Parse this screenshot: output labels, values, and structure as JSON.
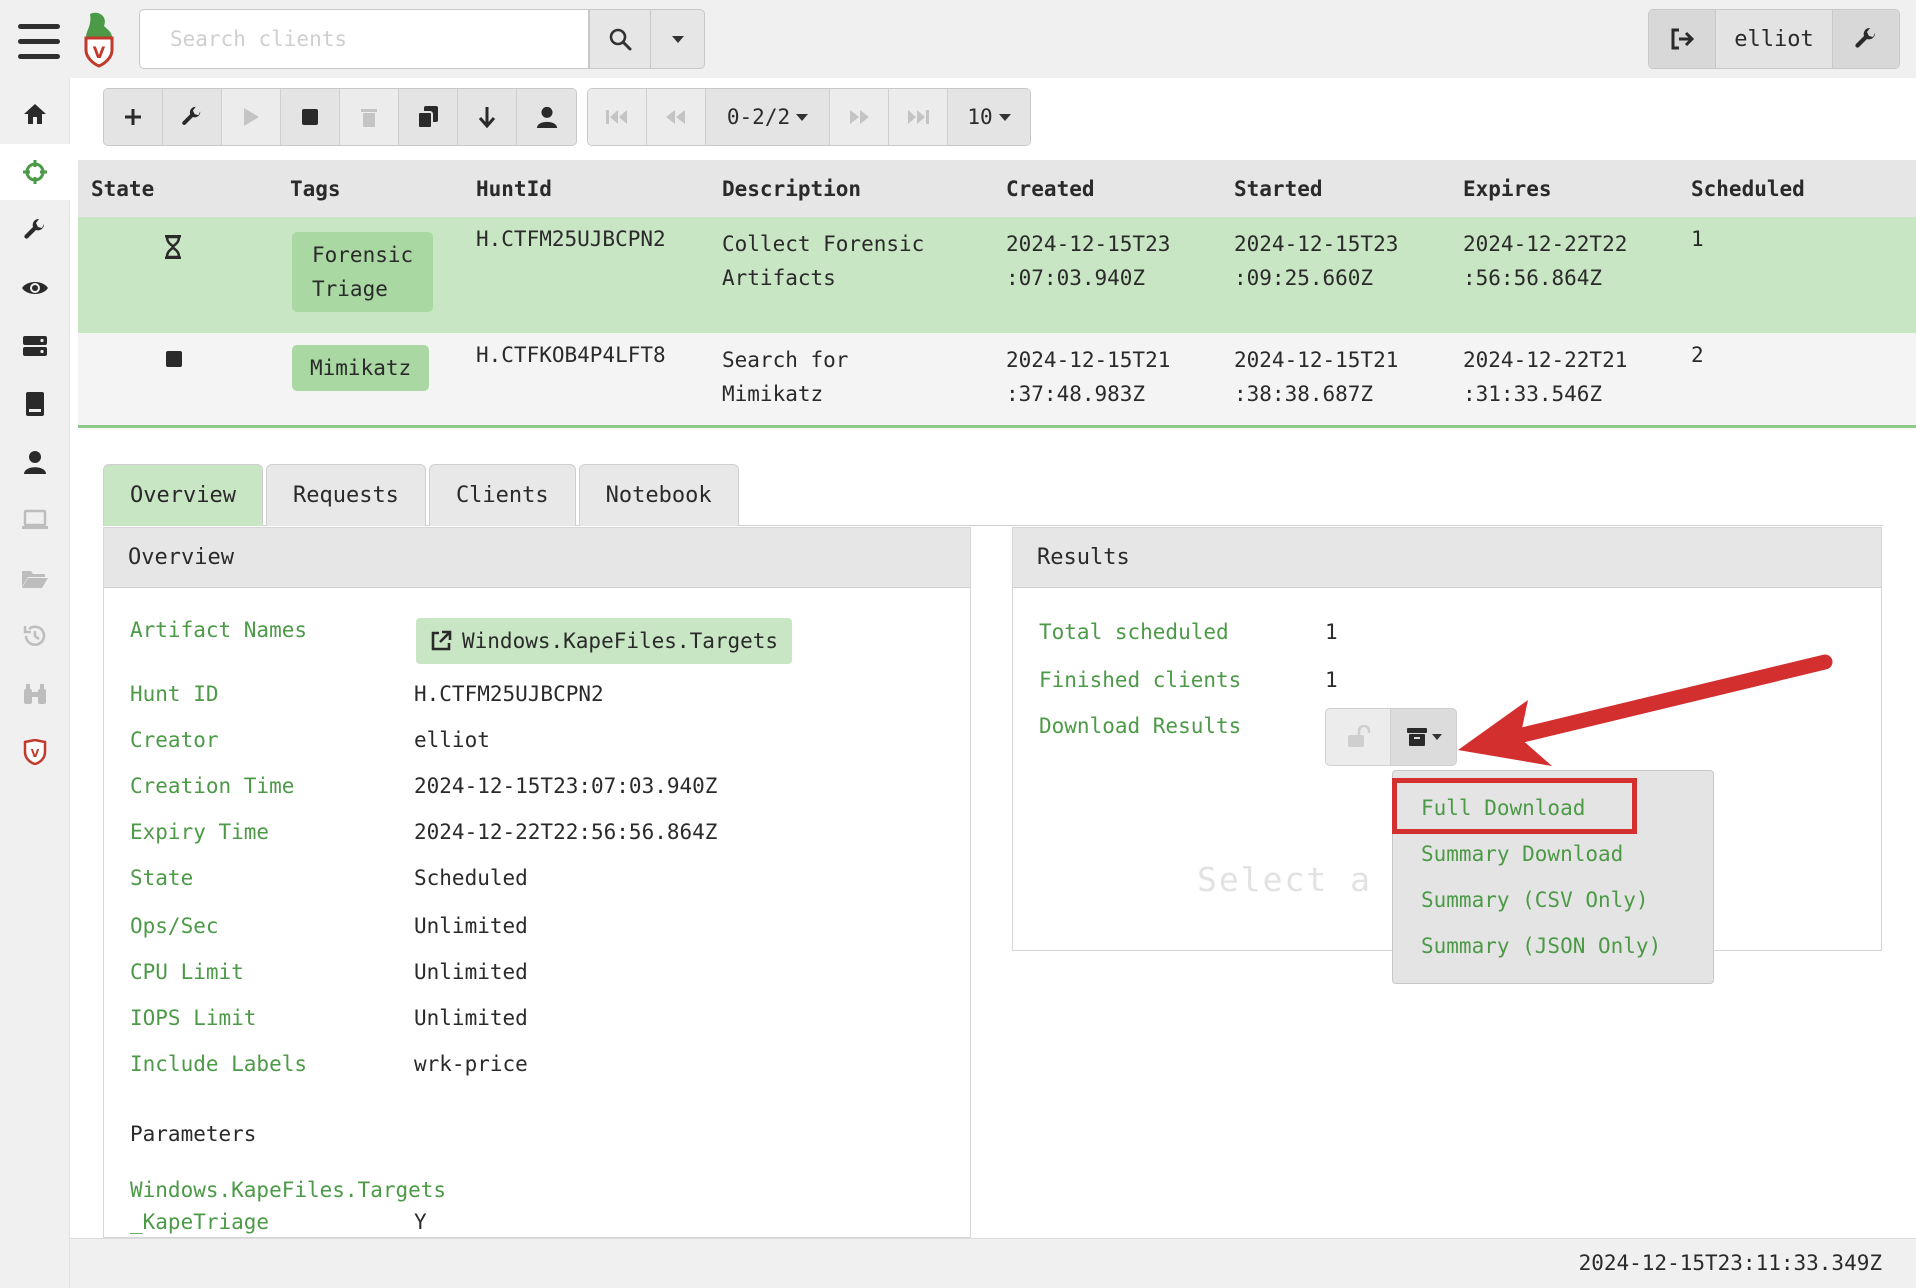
{
  "header": {
    "search_placeholder": "Search clients",
    "username": "elliot"
  },
  "toolbar": {
    "pager_label": "0-2/2",
    "page_size": "10"
  },
  "hunts_table": {
    "columns": [
      "State",
      "Tags",
      "HuntId",
      "Description",
      "Created",
      "Started",
      "Expires",
      "Scheduled"
    ],
    "rows": [
      {
        "state_icon": "hourglass-icon",
        "tag": [
          "Forensic",
          "Triage"
        ],
        "hunt_id": "H.CTFM25UJBCPN2",
        "description": [
          "Collect Forensic",
          "Artifacts"
        ],
        "created": [
          "2024-12-15T23",
          ":07:03.940Z"
        ],
        "started": [
          "2024-12-15T23",
          ":09:25.660Z"
        ],
        "expires": [
          "2024-12-22T22",
          ":56:56.864Z"
        ],
        "scheduled": "1"
      },
      {
        "state_icon": "stop-icon",
        "tag": [
          "Mimikatz"
        ],
        "hunt_id": "H.CTFKOB4P4LFT8",
        "description": [
          "Search for",
          "Mimikatz"
        ],
        "created": [
          "2024-12-15T21",
          ":37:48.983Z"
        ],
        "started": [
          "2024-12-15T21",
          ":38:38.687Z"
        ],
        "expires": [
          "2024-12-22T21",
          ":31:33.546Z"
        ],
        "scheduled": "2"
      }
    ]
  },
  "tabs": [
    "Overview",
    "Requests",
    "Clients",
    "Notebook"
  ],
  "overview": {
    "title": "Overview",
    "artifact_names_label": "Artifact Names",
    "artifact_name": "Windows.KapeFiles.Targets",
    "fields": [
      {
        "label": "Hunt ID",
        "value": "H.CTFM25UJBCPN2"
      },
      {
        "label": "Creator",
        "value": "elliot"
      },
      {
        "label": "Creation Time",
        "value": "2024-12-15T23:07:03.940Z"
      },
      {
        "label": "Expiry Time",
        "value": "2024-12-22T22:56:56.864Z"
      },
      {
        "label": "State",
        "value": "Scheduled"
      },
      {
        "label": "Ops/Sec",
        "value": "Unlimited"
      },
      {
        "label": "CPU Limit",
        "value": "Unlimited"
      },
      {
        "label": "IOPS Limit",
        "value": "Unlimited"
      },
      {
        "label": "Include Labels",
        "value": "wrk-price"
      }
    ],
    "parameters_title": "Parameters",
    "param_artifact": "Windows.KapeFiles.Targets",
    "param_name": "_KapeTriage",
    "param_value": "Y"
  },
  "results": {
    "title": "Results",
    "total_scheduled_label": "Total scheduled",
    "total_scheduled": "1",
    "finished_clients_label": "Finished clients",
    "finished_clients": "1",
    "download_results_label": "Download Results",
    "ghost_text": "Select a c",
    "download_menu": [
      "Full Download",
      "Summary Download",
      "Summary (CSV Only)",
      "Summary (JSON Only)"
    ]
  },
  "footer": {
    "timestamp": "2024-12-15T23:11:33.349Z"
  },
  "colors": {
    "accent_green": "#4c9a47",
    "selected_row": "#c8e6c3",
    "highlight_red": "#d32f2f"
  }
}
